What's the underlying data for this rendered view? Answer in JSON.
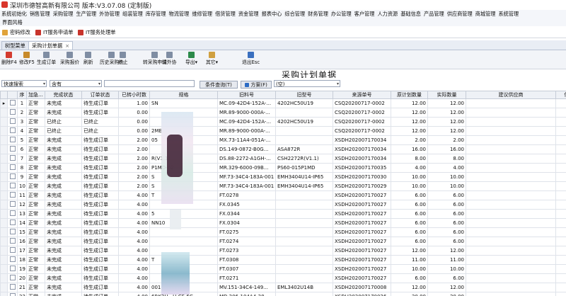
{
  "window": {
    "title": "深圳市德智高新有限公司 版本:V3.07.08 (定制版)"
  },
  "menu": [
    "系统初始化",
    "销售管理",
    "采购管理",
    "生产管理",
    "外协管理",
    "组装管理",
    "库存管理",
    "物流管理",
    "维修管理",
    "借货管理",
    "资金管理",
    "报表中心",
    "综合管理",
    "财务管理",
    "办公管理",
    "客户管理",
    "人力资源",
    "基础信息",
    "产品管理",
    "供应商管理",
    "商城管理",
    "系统管理"
  ],
  "submenu": "界面风格",
  "quick": [
    "密码修改",
    "IT服务申请单",
    "IT服务处理单"
  ],
  "tabs": [
    {
      "label": "树型菜单"
    },
    {
      "label": "采购计划单据",
      "close": "×"
    }
  ],
  "toolbar": [
    "删除F4",
    "修改F5",
    "生成订单",
    "采购报价",
    "刷新",
    "历史采购价",
    "终止",
    "转采购申请",
    "转外协",
    "导出",
    "其它",
    "退出Esc"
  ],
  "toolbar_arrows": {
    "export": "▾",
    "other": "▾"
  },
  "filter": {
    "field": "快速搜索",
    "op": "含有",
    "value": "",
    "query_btn": "条件查询(T)",
    "scheme_btn": "方案(F)",
    "scheme_value": "(空)",
    "arrow": "▾"
  },
  "form_title": "采购计划单据",
  "grid": {
    "columns": [
      "",
      "",
      "序",
      "加急...",
      "完成状态",
      "订单状态",
      "已转小时数",
      "规格",
      "旧料号",
      "旧型号",
      "来源单号",
      "原计划数量",
      "实际数量",
      "建议供应商",
      "供应"
    ],
    "row_marker": "▸",
    "rows": [
      [
        "1",
        "正常",
        "未完成",
        "待生成订单",
        "1.00",
        "SN",
        "MC.09-42D4-152A-...",
        "4202HC50U19",
        "CSQ20200717-0002",
        "12.00",
        "12.00"
      ],
      [
        "2",
        "正常",
        "未完成",
        "待生成订单",
        "0.00",
        "",
        "MR.89-9000-000A-...",
        "",
        "CSQ20200717-0002",
        "12.00",
        "12.00"
      ],
      [
        "3",
        "正常",
        "已终止",
        "已终止",
        "0.00",
        "",
        "MC.09-42D4-152A-...",
        "4202HC50U19",
        "CSQ20200717-0002",
        "12.00",
        "12.00"
      ],
      [
        "4",
        "正常",
        "已终止",
        "已终止",
        "0.00",
        "2ME",
        "MR.89-9000-000A-...",
        "",
        "CSQ20200717-0002",
        "12.00",
        "12.00"
      ],
      [
        "5",
        "正常",
        "未完成",
        "待生成订单",
        "2.00",
        "05",
        "MX.73-11A4-051A-...",
        "",
        "XSDH202007170034",
        "2.00",
        "2.00"
      ],
      [
        "6",
        "正常",
        "未完成",
        "待生成订单",
        "2.00",
        "",
        "DS.149-0872-B0G...",
        "ASA872R",
        "XSDH202007170034",
        "16.00",
        "16.00"
      ],
      [
        "7",
        "正常",
        "未完成",
        "待生成订单",
        "2.00",
        "R(V1.1)",
        "DS.88-2272-A1GH-...",
        "CSH2272R(V1.1)",
        "XSDH202007170034",
        "8.00",
        "8.00"
      ],
      [
        "8",
        "正常",
        "未完成",
        "待生成订单",
        "2.00",
        "P1MD-02",
        "MR.329-6000-09B...",
        "PS60-015P1MD",
        "XSDH202007170035",
        "4.00",
        "4.00"
      ],
      [
        "9",
        "正常",
        "未完成",
        "待生成订单",
        "2.00",
        "S",
        "MF.73-34C4-183A-001",
        "EMH3404U14-IP65",
        "XSDH202007170030",
        "10.00",
        "10.00"
      ],
      [
        "10",
        "正常",
        "未完成",
        "待生成订单",
        "2.00",
        "S",
        "MF.73-34C4-183A-001",
        "EMH3404U14-IP65",
        "XSDH202007170029",
        "10.00",
        "10.00"
      ],
      [
        "11",
        "正常",
        "未完成",
        "待生成订单",
        "4.00",
        "T",
        "FT.0278",
        "",
        "XSDH202007170027",
        "6.00",
        "6.00"
      ],
      [
        "12",
        "正常",
        "未完成",
        "待生成订单",
        "4.00",
        "",
        "FX.0345",
        "",
        "XSDH202007170027",
        "6.00",
        "6.00"
      ],
      [
        "13",
        "正常",
        "未完成",
        "待生成订单",
        "4.00",
        "5",
        "FX.0344",
        "",
        "XSDH202007170027",
        "6.00",
        "6.00"
      ],
      [
        "14",
        "正常",
        "未完成",
        "待生成订单",
        "4.00",
        "NN10",
        "FX.0304",
        "",
        "XSDH202007170027",
        "6.00",
        "6.00"
      ],
      [
        "15",
        "正常",
        "未完成",
        "待生成订单",
        "4.00",
        "",
        "FT.0275",
        "",
        "XSDH202007170027",
        "6.00",
        "6.00"
      ],
      [
        "16",
        "正常",
        "未完成",
        "待生成订单",
        "4.00",
        "",
        "FT.0274",
        "",
        "XSDH202007170027",
        "6.00",
        "6.00"
      ],
      [
        "17",
        "正常",
        "未完成",
        "待生成订单",
        "4.00",
        "",
        "FT.0273",
        "",
        "XSDH202007170027",
        "12.00",
        "12.00"
      ],
      [
        "18",
        "正常",
        "未完成",
        "待生成订单",
        "4.00",
        "T",
        "FT.0308",
        "",
        "XSDH202007170027",
        "11.00",
        "11.00"
      ],
      [
        "19",
        "正常",
        "未完成",
        "待生成订单",
        "4.00",
        "",
        "FT.0307",
        "",
        "XSDH202007170027",
        "10.00",
        "10.00"
      ],
      [
        "20",
        "正常",
        "未完成",
        "待生成订单",
        "4.00",
        "",
        "FT.0271",
        "",
        "XSDH202007170027",
        "6.00",
        "6.00"
      ],
      [
        "21",
        "正常",
        "未完成",
        "待生成订单",
        "4.00",
        "001",
        "MV.151-34C4-149...",
        "EML3402U14B",
        "XSDH202007170008",
        "12.00",
        "12.00"
      ],
      [
        "22",
        "正常",
        "未完成",
        "待生成订单",
        "4.00",
        "6RK2U...U-CF-6G...",
        "MD.206-104A4-28...",
        "",
        "XSDH202007170026",
        "20.00",
        "20.00"
      ]
    ]
  },
  "colors": {
    "accent": "#1f5fa8",
    "header_bg": "#eef1f6",
    "toolbar_bg": "#f2f4f8"
  }
}
